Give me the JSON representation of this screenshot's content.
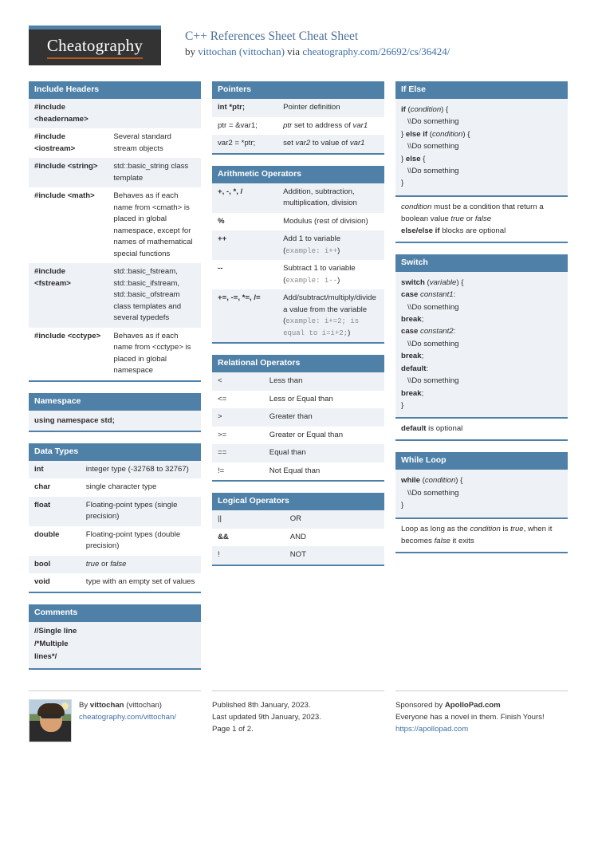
{
  "brand": {
    "logo": "Cheatography"
  },
  "header": {
    "title": "C++ References Sheet Cheat Sheet",
    "by_prefix": "by ",
    "author": "vittochan (vittochan)",
    "via": " via ",
    "source_url": "cheatography.com/26692/cs/36424/"
  },
  "columns": [
    {
      "blocks": [
        {
          "title": "Include Headers",
          "type": "table",
          "col1_class": "c1w",
          "rows": [
            {
              "k": "#include <headername>",
              "v": ""
            },
            {
              "k": "#include <iostream>",
              "v": "Several standard stream objects"
            },
            {
              "k": "#include <string>",
              "v": "std::basic_string class template"
            },
            {
              "k": "#include <math>",
              "v": "Behaves as if each name from <cmath> is placed in global namespace, except for names of mathematical special functions"
            },
            {
              "k": "#include <fstream>",
              "v": "std::basic_fstream, std::basic_ifstream, std::basic_ofstream class templates and several typedefs"
            },
            {
              "k": "#include <cctype>",
              "v": "Behaves as if each name from <cctype> is placed in global namespace"
            }
          ]
        },
        {
          "title": "Namespace",
          "type": "single",
          "text": "using namespace std;"
        },
        {
          "title": "Data Types",
          "type": "table",
          "col1_class": "c1n",
          "rows": [
            {
              "k": "int",
              "v": "integer type (-32768 to 32767)"
            },
            {
              "k": "char",
              "v": "single character type"
            },
            {
              "k": "float",
              "v": "Floating-point types (single precision)"
            },
            {
              "k": "double",
              "v": "Floating-point types (double precision)"
            },
            {
              "k": "bool",
              "v_html": "<i>true</i> or <i>false</i>"
            },
            {
              "k": "void",
              "v": "type with an empty set of values"
            }
          ]
        },
        {
          "title": "Comments",
          "type": "lines",
          "lines": [
            "//Single line",
            "/*Multiple",
            "lines*/"
          ]
        }
      ]
    },
    {
      "blocks": [
        {
          "title": "Pointers",
          "type": "table",
          "col1_class": "c1x",
          "rows": [
            {
              "k": "int *ptr;",
              "v": "Pointer definition"
            },
            {
              "k": "ptr = &var1;",
              "k_plain": true,
              "v_html": "<i>ptr</i> set to address of <i>var1</i>"
            },
            {
              "k": "var2 = *ptr;",
              "k_plain": true,
              "v_html": "set <i>var2</i> to value of <i>var1</i>"
            }
          ]
        },
        {
          "title": "Arithmetic Operators",
          "type": "table",
          "col1_class": "c1x",
          "rows": [
            {
              "k": "+, -, *, /",
              "v": "Addition, subtraction, multiplication, division"
            },
            {
              "k": "%",
              "v": "Modulus (rest of division)"
            },
            {
              "k": "++",
              "v_html": "Add 1 to variable (<code>example: i++</code>)"
            },
            {
              "k": "--",
              "v_html": "Subtract 1 to variable (<code>example: i--</code>)"
            },
            {
              "k": "+=, -=, *=, /=",
              "v_html": "Add/subtract/multiply/divide a value from the variable (<code>example: i+=2; is equal to i=i+2;</code>)"
            }
          ]
        },
        {
          "title": "Relational Operators",
          "type": "table",
          "col1_class": "c1n",
          "rows": [
            {
              "k": "<",
              "k_plain": true,
              "v": "Less than"
            },
            {
              "k": "<=",
              "k_plain": true,
              "v": "Less or Equal than"
            },
            {
              "k": ">",
              "k_plain": true,
              "v": "Greater than"
            },
            {
              "k": ">=",
              "k_plain": true,
              "v": "Greater or Equal than"
            },
            {
              "k": "==",
              "k_plain": true,
              "v": "Equal than"
            },
            {
              "k": "!=",
              "k_plain": true,
              "v": "Not Equal than"
            }
          ]
        },
        {
          "title": "Logical Operators",
          "type": "table",
          "col1_class": "c1",
          "rows": [
            {
              "k": "||",
              "k_plain": true,
              "v": "OR"
            },
            {
              "k": "&&",
              "v": "AND"
            },
            {
              "k": "!",
              "k_plain": true,
              "v": "NOT"
            }
          ]
        }
      ]
    },
    {
      "blocks": [
        {
          "title": "If Else",
          "type": "code",
          "code_html": "<b>if</b> (<i>condition</i>) {\n   \\\\Do something\n} <b>else if</b> (<i>condition</i>) {\n   \\\\Do something\n} <b>else</b> {\n   \\\\Do something\n}",
          "note_html": "<i>condition</i> must be a condition that return a boolean value <i>true</i> or <i>false</i><br><b>else/else if</b> blocks are optional"
        },
        {
          "title": "Switch",
          "type": "code",
          "code_html": "<b>switch</b> (<i>variable</i>) {\n<b>case</b> <i>constant1</i>:\n   \\\\Do something\n<b>break</b>;\n<b>case</b> <i>constant2</i>:\n   \\\\Do something\n<b>break</b>;\n<b>default</b>:\n   \\\\Do something\n<b>break</b>;\n}",
          "note_html": "<b>default</b> is optional"
        },
        {
          "title": "While Loop",
          "type": "code",
          "code_html": "<b>while</b> (<i>condition</i>) {\n   \\\\Do something\n}",
          "note_html": "Loop as long as the <i>condition</i> is <i>true</i>, when it becomes <i>false</i> it exits"
        }
      ]
    }
  ],
  "footer": {
    "author_line_prefix": "By ",
    "author_name": "vittochan",
    "author_handle": " (vittochan)",
    "author_url": "cheatography.com/vittochan/",
    "published": "Published 8th January, 2023.",
    "updated": "Last updated 9th January, 2023.",
    "page": "Page 1 of 2.",
    "sponsor_prefix": "Sponsored by ",
    "sponsor_name": "ApolloPad.com",
    "sponsor_tagline": "Everyone has a novel in them. Finish Yours!",
    "sponsor_url": "https://apollopad.com"
  },
  "colors": {
    "accent": "#4f81a8",
    "link": "#3f6fa5",
    "stripe": "#eef2f6",
    "logo_bg": "#333333",
    "logo_underline": "#b5581f"
  }
}
